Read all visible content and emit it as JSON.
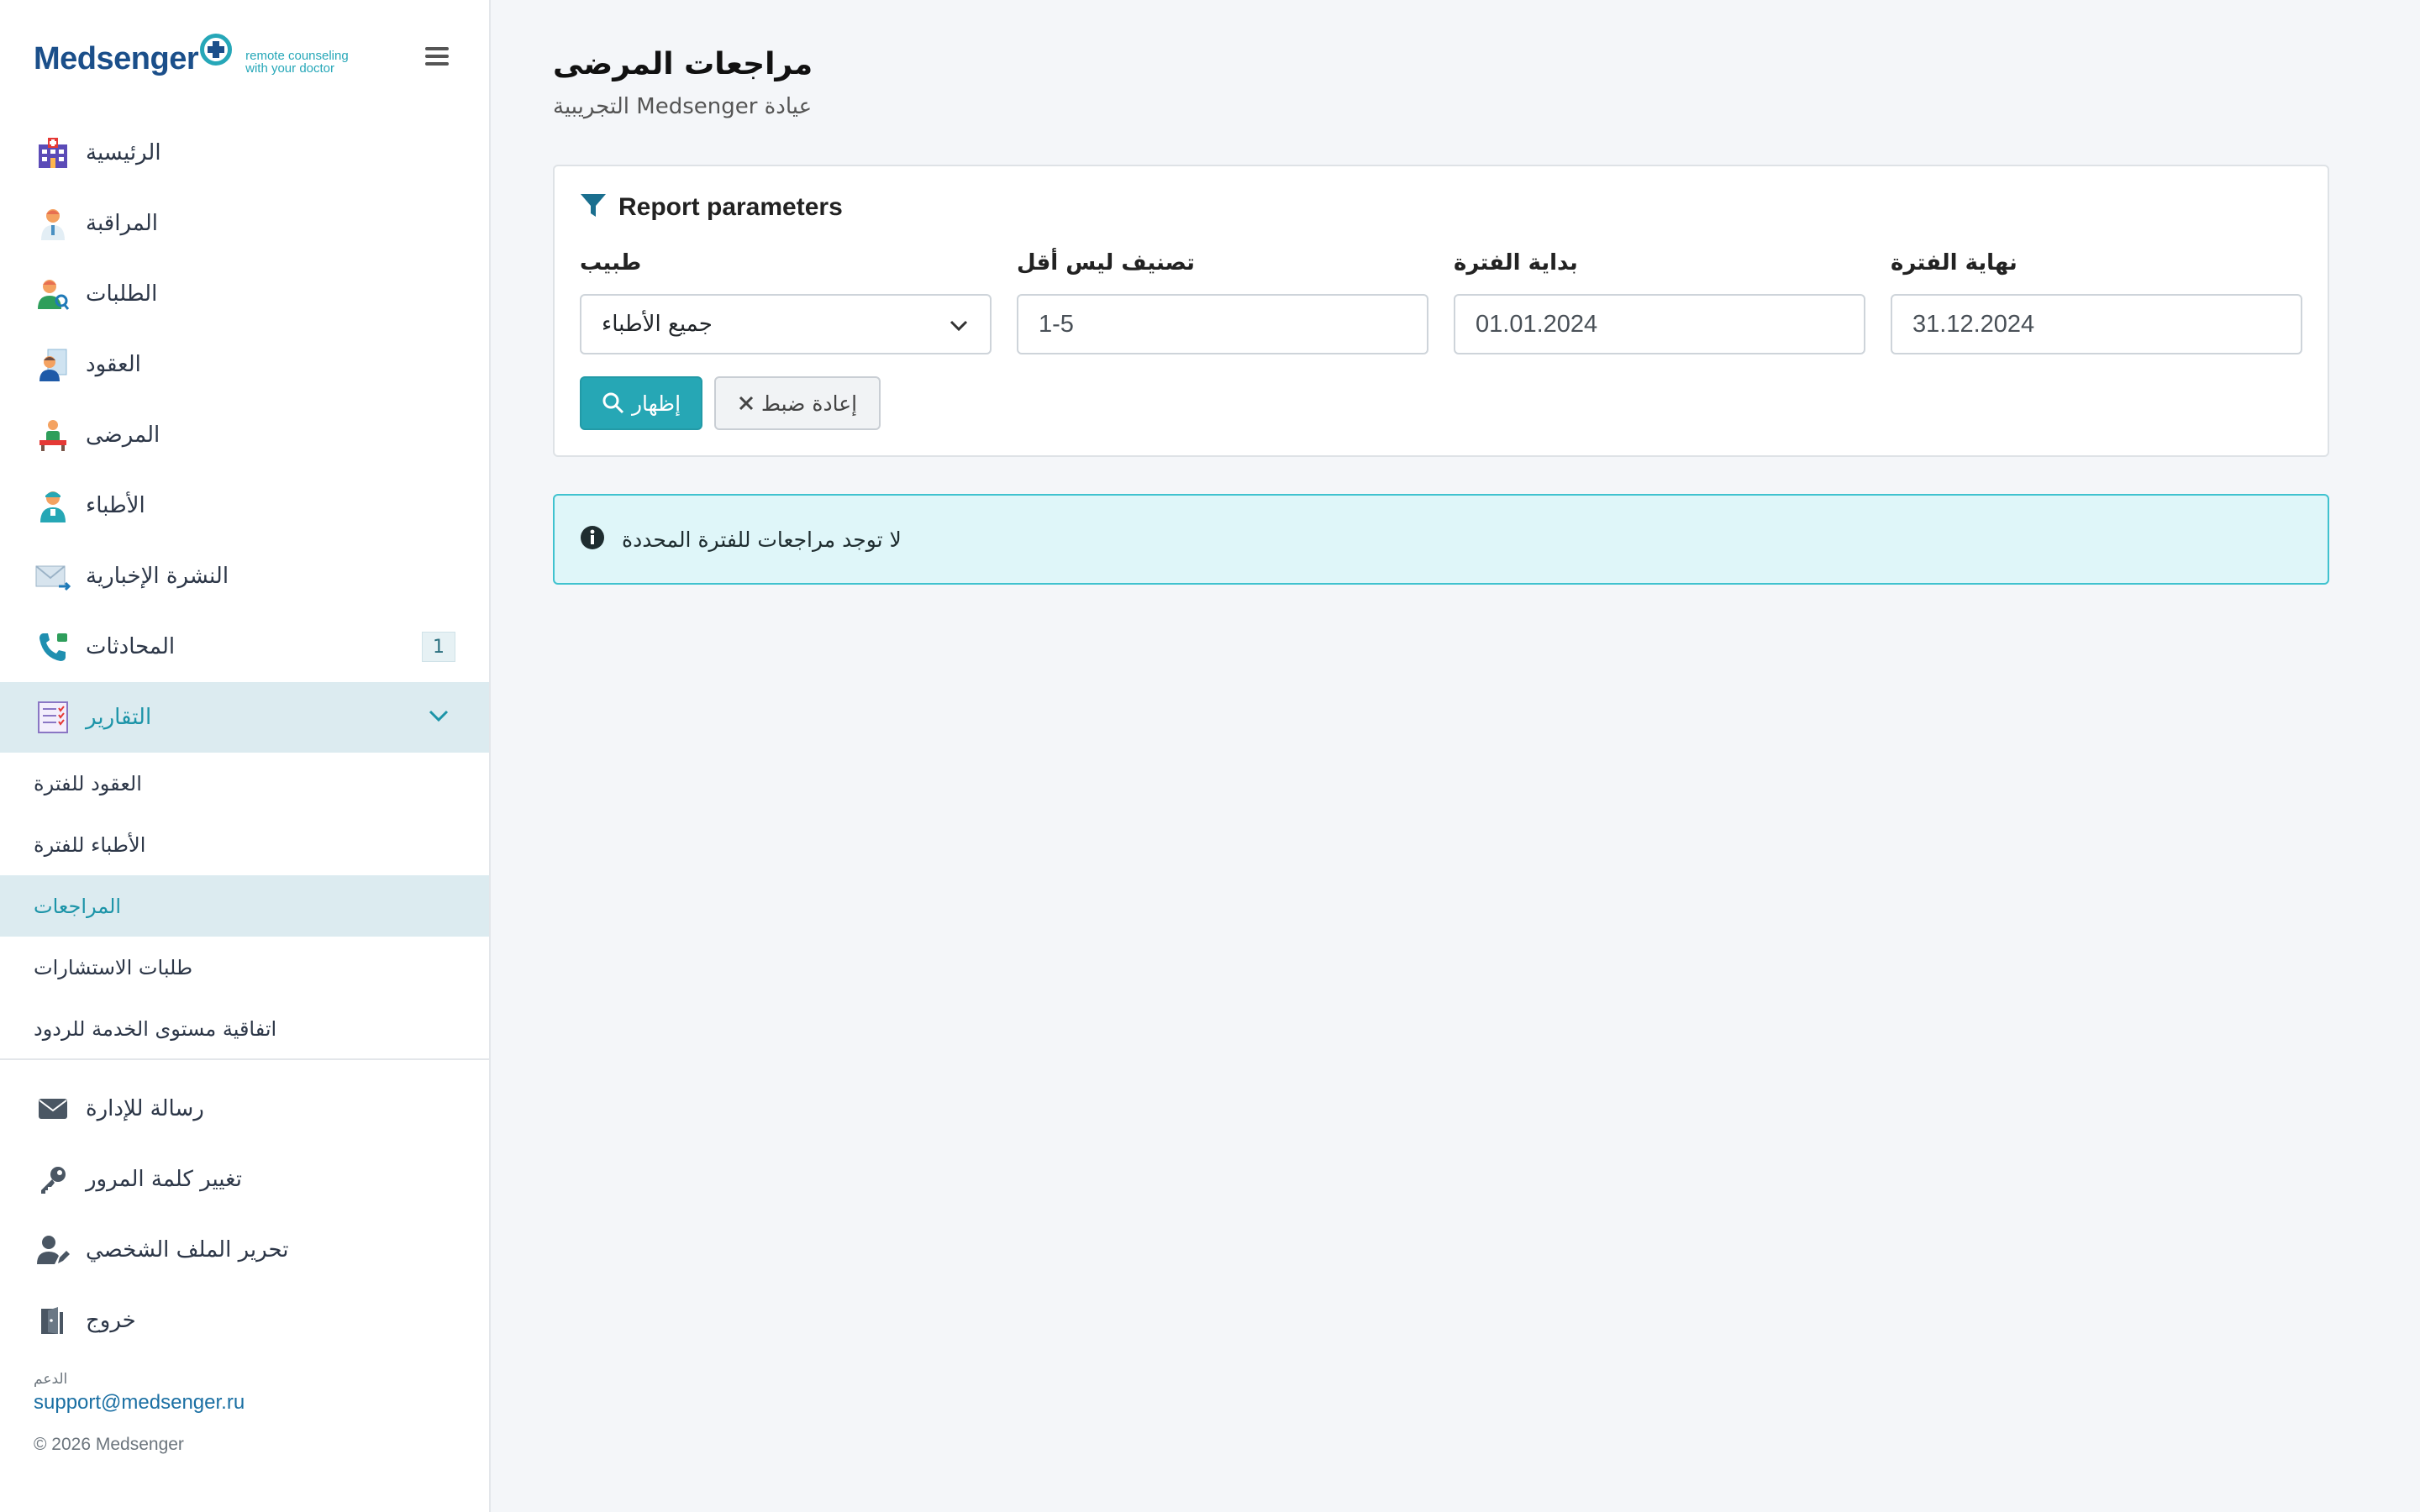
{
  "brand": {
    "name_part1": "Med",
    "name_part2": "senger",
    "tagline_line1": "remote counseling",
    "tagline_line2": "with your doctor"
  },
  "sidebar": {
    "nav": [
      {
        "label": "الرئيسية",
        "icon": "hospital-icon"
      },
      {
        "label": "المراقبة",
        "icon": "doctor-icon"
      },
      {
        "label": "الطلبات",
        "icon": "user-search-icon"
      },
      {
        "label": "العقود",
        "icon": "contract-icon"
      },
      {
        "label": "المرضى",
        "icon": "patient-icon"
      },
      {
        "label": "الأطباء",
        "icon": "medic-icon"
      },
      {
        "label": "النشرة الإخبارية",
        "icon": "newsletter-icon"
      },
      {
        "label": "المحادثات",
        "icon": "phone-icon",
        "badge": "1"
      },
      {
        "label": "التقارير",
        "icon": "reports-icon"
      }
    ],
    "reports_sub": [
      {
        "label": "العقود للفترة"
      },
      {
        "label": "الأطباء للفترة"
      },
      {
        "label": "المراجعات"
      },
      {
        "label": "طلبات الاستشارات"
      },
      {
        "label": "اتفاقية مستوى الخدمة للردود"
      }
    ],
    "bottom": [
      {
        "label": "رسالة للإدارة",
        "icon": "envelope-icon"
      },
      {
        "label": "تغيير كلمة المرور",
        "icon": "key-icon"
      },
      {
        "label": "تحرير الملف الشخصي",
        "icon": "user-edit-icon"
      },
      {
        "label": "خروج",
        "icon": "door-exit-icon"
      }
    ],
    "support_caption": "الدعم",
    "support_email": "support@medsenger.ru",
    "copyright": "© 2026 Medsenger"
  },
  "main": {
    "title": "مراجعات المرضى",
    "subtitle": "التجريبية Medsenger عيادة",
    "params": {
      "heading": "Report parameters",
      "doctor_label": "طبيب",
      "doctor_value": "جميع الأطباء",
      "rating_label": "تصنيف ليس أقل",
      "rating_value": "1-5",
      "start_label": "بداية الفترة",
      "start_value": "01.01.2024",
      "end_label": "نهاية الفترة",
      "end_value": "31.12.2024",
      "show_button": "إظهار",
      "reset_button": "إعادة ضبط"
    },
    "alert_text": "لا توجد مراجعات للفترة المحددة"
  },
  "colors": {
    "accent": "#26a7b5",
    "brand_dark": "#1b4f8a",
    "active_bg": "#dcebf0",
    "alert_bg": "#dff6f9"
  }
}
